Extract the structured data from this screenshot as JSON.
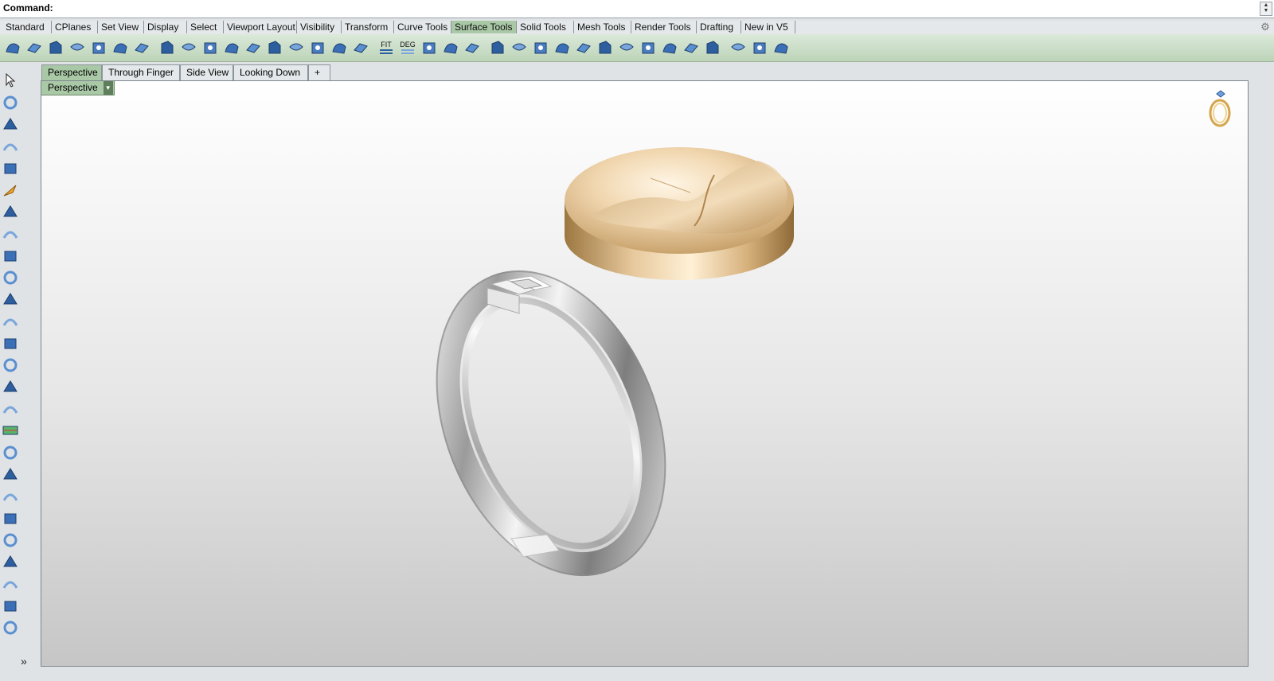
{
  "command": {
    "label": "Command:",
    "value": ""
  },
  "toolbar_tabs": [
    {
      "label": "Standard",
      "active": false
    },
    {
      "label": "CPlanes",
      "active": false
    },
    {
      "label": "Set View",
      "active": false
    },
    {
      "label": "Display",
      "active": false
    },
    {
      "label": "Select",
      "active": false
    },
    {
      "label": "Viewport Layout",
      "active": false
    },
    {
      "label": "Visibility",
      "active": false
    },
    {
      "label": "Transform",
      "active": false
    },
    {
      "label": "Curve Tools",
      "active": false
    },
    {
      "label": "Surface Tools",
      "active": true
    },
    {
      "label": "Solid Tools",
      "active": false
    },
    {
      "label": "Mesh Tools",
      "active": false
    },
    {
      "label": "Render Tools",
      "active": false
    },
    {
      "label": "Drafting",
      "active": false
    },
    {
      "label": "New in V5",
      "active": false
    }
  ],
  "toolbar_icons": [
    {
      "name": "surface-icon",
      "text": ""
    },
    {
      "name": "plane-surface-icon",
      "text": ""
    },
    {
      "name": "edge-surface-icon",
      "text": ""
    },
    {
      "name": "offset-surface-icon",
      "text": ""
    },
    {
      "name": "extend-surface-icon",
      "text": ""
    },
    {
      "name": "fillet-surface-icon",
      "text": ""
    },
    {
      "name": "blend-curve-icon",
      "text": ""
    },
    {
      "name": "chamfer-surface-icon",
      "text": ""
    },
    {
      "name": "variable-fillet-icon",
      "text": ""
    },
    {
      "name": "merge-surface-icon",
      "text": ""
    },
    {
      "name": "connect-surface-icon",
      "text": ""
    },
    {
      "name": "match-surface-icon",
      "text": ""
    },
    {
      "name": "shrink-surface-icon",
      "text": ""
    },
    {
      "name": "unroll-surface-icon",
      "text": ""
    },
    {
      "name": "flow-along-surface-icon",
      "text": ""
    },
    {
      "name": "analyze-surface-icon",
      "text": ""
    },
    {
      "name": "curvature-analysis-icon",
      "text": ""
    },
    {
      "name": "fit-surface-icon",
      "text": "FIT"
    },
    {
      "name": "change-degree-icon",
      "text": "DEG"
    },
    {
      "name": "rebuild-surface-icon",
      "text": ""
    },
    {
      "name": "rebuild-uv-icon",
      "text": ""
    },
    {
      "name": "refit-trim-icon",
      "text": ""
    },
    {
      "name": "show-edges-icon",
      "text": ""
    },
    {
      "name": "control-points-icon",
      "text": ""
    },
    {
      "name": "surface-point-icon",
      "text": ""
    },
    {
      "name": "cylinder-surface-icon",
      "text": ""
    },
    {
      "name": "split-edge-icon",
      "text": ""
    },
    {
      "name": "symmetry-icon",
      "text": ""
    },
    {
      "name": "transfer-icon",
      "text": ""
    },
    {
      "name": "trim-icon",
      "text": ""
    },
    {
      "name": "extract-isocurve-icon",
      "text": ""
    },
    {
      "name": "edit-icon",
      "text": ""
    },
    {
      "name": "contour-icon",
      "text": ""
    },
    {
      "name": "zebra-icon",
      "text": ""
    },
    {
      "name": "draft-angle-icon",
      "text": ""
    },
    {
      "name": "curve-on-surface-icon",
      "text": ""
    }
  ],
  "left_tools": [
    "select-arrow-icon",
    "point-icon",
    "polyline-icon",
    "line-icon",
    "curve-gear-icon",
    "arc-icon",
    "rectangle-icon",
    "box-icon",
    "circle-icon",
    "ellipse-icon",
    "polygon-icon",
    "transform-icon",
    "array-icon",
    "plane-icon",
    "projection-icon",
    "curve-edit-icon",
    "analyze-grid-icon",
    "solid-box-icon",
    "solid-sphere-icon",
    "solid-cylinder-icon",
    "cone-icon",
    "pipe-icon",
    "mesh-icon",
    "loft-icon",
    "revolve-icon",
    "sweep-icon"
  ],
  "viewport_tabs": [
    {
      "label": "Perspective",
      "active": true
    },
    {
      "label": "Through Finger",
      "active": false
    },
    {
      "label": "Side View",
      "active": false
    },
    {
      "label": "Looking Down",
      "active": false
    },
    {
      "label": "+",
      "active": false
    }
  ],
  "viewport": {
    "title": "Perspective"
  },
  "scene_objects": [
    "gold-disc",
    "silver-ring"
  ],
  "colors": {
    "active_tab": "#a9c8a6",
    "gold": "#d9b887",
    "silver": "#c8c8c8"
  }
}
